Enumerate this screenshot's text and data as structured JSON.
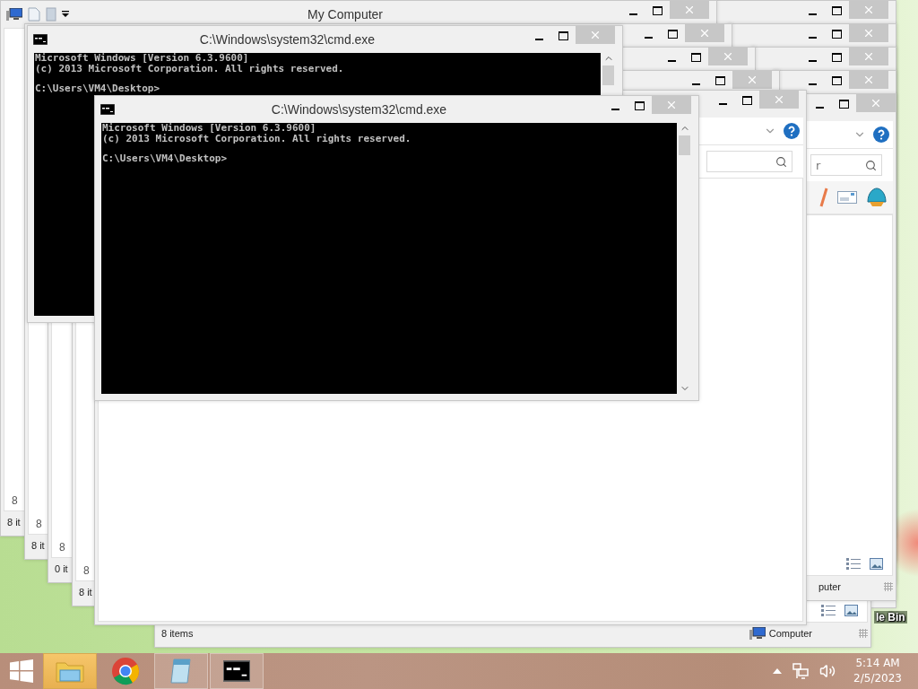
{
  "windows": [
    {
      "kind": "explorer"
    },
    {
      "kind": "explorer"
    },
    {
      "kind": "explorer"
    },
    {
      "kind": "explorer"
    },
    {
      "kind": "explorer",
      "title": "My Computer",
      "item_count": "8",
      "status": "8 it"
    },
    {
      "kind": "explorer",
      "item_count": "8",
      "status": "8 it"
    },
    {
      "kind": "explorer",
      "item_count": "8",
      "status": "0 it"
    },
    {
      "kind": "explorer",
      "item_count": "8",
      "status": "8 it"
    },
    {
      "kind": "explorer",
      "status": "8 items",
      "location": "Computer"
    },
    {
      "kind": "explorer",
      "location": "puter",
      "search_placeholder": "r"
    },
    {
      "kind": "explorer"
    },
    {
      "kind": "console",
      "title": "C:\\Windows\\system32\\cmd.exe",
      "banner": [
        "Microsoft Windows [Version 6.3.9600]",
        "(c) 2013 Microsoft Corporation. All rights reserved."
      ],
      "prompt": "C:\\Users\\VM4\\Desktop>"
    },
    {
      "kind": "console",
      "title": "C:\\Windows\\system32\\cmd.exe",
      "banner": [
        "Microsoft Windows [Version 6.3.9600]",
        "(c) 2013 Microsoft Corporation. All rights reserved."
      ],
      "prompt": "C:\\Users\\VM4\\Desktop>"
    }
  ],
  "desktop_icons": [
    {
      "label": "le Bin"
    }
  ],
  "taskbar": {
    "apps": [
      {
        "kind": "explorer",
        "selected": true,
        "open": true
      },
      {
        "kind": "chrome",
        "selected": false,
        "open": false
      },
      {
        "kind": "notepad",
        "selected": false,
        "open": true
      },
      {
        "kind": "console",
        "selected": false,
        "open": true
      }
    ],
    "clock": {
      "time": "5:14 AM",
      "date": "2/5/2023"
    }
  }
}
